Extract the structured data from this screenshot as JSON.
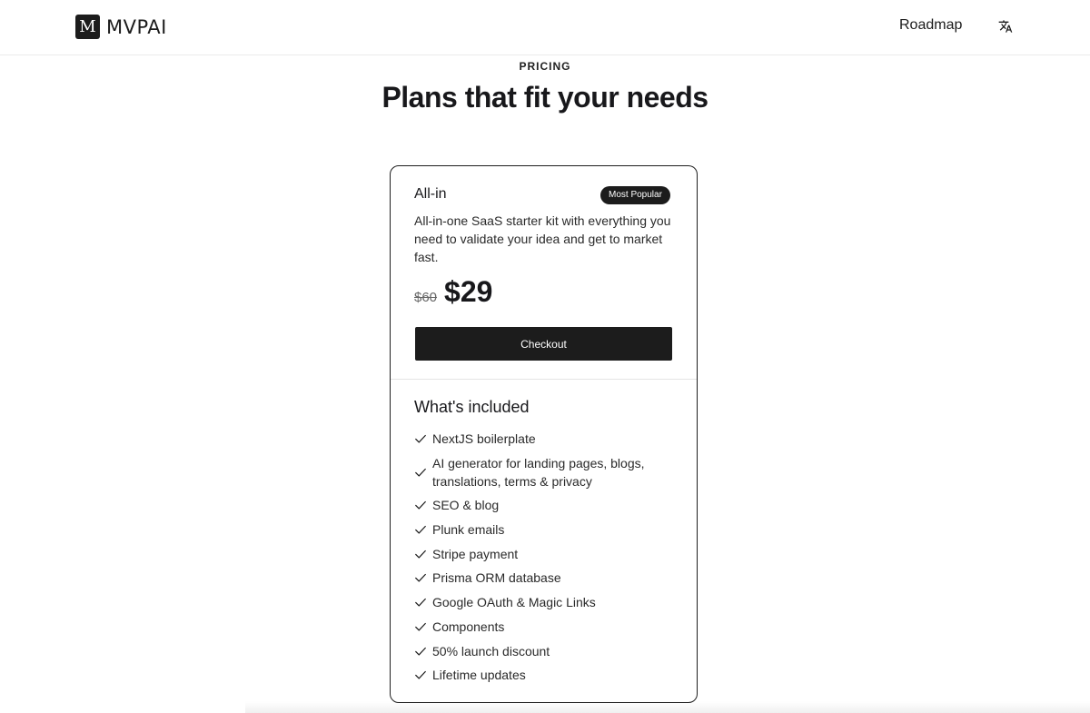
{
  "header": {
    "logo_letter": "M",
    "brand": "MVPAI",
    "nav_roadmap": "Roadmap",
    "translate_icon": "translate-icon"
  },
  "hero": {
    "eyebrow": "PRICING",
    "title": "Plans that fit your needs"
  },
  "plan": {
    "name": "All-in",
    "badge": "Most Popular",
    "description": "All-in-one SaaS starter kit with everything you need to validate your idea and get to market fast.",
    "price_old": "$60",
    "price_new": "$29",
    "checkout_label": "Checkout",
    "included_title": "What's included",
    "check_icon": "check-icon",
    "features": [
      "NextJS boilerplate",
      "AI generator for landing pages, blogs, translations, terms & privacy",
      "SEO & blog",
      "Plunk emails",
      "Stripe payment",
      "Prisma ORM database",
      "Google OAuth & Magic Links",
      "Components",
      "50% launch discount",
      "Lifetime updates"
    ]
  },
  "colors": {
    "primary": "#1c1c1c",
    "text": "#18181b",
    "border": "#e5e5e5"
  }
}
